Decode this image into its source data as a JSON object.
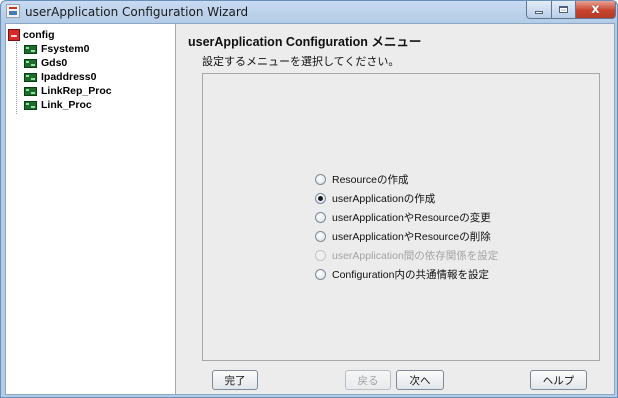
{
  "window": {
    "title": "userApplication Configuration Wizard",
    "close_glyph": "x"
  },
  "tree": {
    "root": {
      "label": "config",
      "icon": "config-folder-icon"
    },
    "children": [
      {
        "label": "Fsystem0",
        "icon": "resource-node-icon"
      },
      {
        "label": "Gds0",
        "icon": "resource-node-icon"
      },
      {
        "label": "Ipaddress0",
        "icon": "resource-node-icon"
      },
      {
        "label": "LinkRep_Proc",
        "icon": "resource-node-icon"
      },
      {
        "label": "Link_Proc",
        "icon": "resource-node-icon"
      }
    ]
  },
  "main": {
    "heading": "userApplication Configuration メニュー",
    "instruction": "設定するメニューを選択してください。",
    "options": [
      {
        "label": "Resourceの作成",
        "selected": false,
        "enabled": true
      },
      {
        "label": "userApplicationの作成",
        "selected": true,
        "enabled": true
      },
      {
        "label": "userApplicationやResourceの変更",
        "selected": false,
        "enabled": true
      },
      {
        "label": "userApplicationやResourceの削除",
        "selected": false,
        "enabled": true
      },
      {
        "label": "userApplication間の依存関係を設定",
        "selected": false,
        "enabled": false
      },
      {
        "label": "Configuration内の共通情報を設定",
        "selected": false,
        "enabled": true
      }
    ]
  },
  "buttons": {
    "finish": "完了",
    "back": "戻る",
    "next": "次へ",
    "help": "ヘルプ"
  },
  "colors": {
    "titlebar": "#b4cbe6",
    "close_button": "#c8442e",
    "panel_background": "#ececec",
    "tree_background": "#ffffff",
    "root_icon": "#d42a2a",
    "node_icon": "#1d6b2a",
    "disabled_text": "#a3a3a3"
  }
}
